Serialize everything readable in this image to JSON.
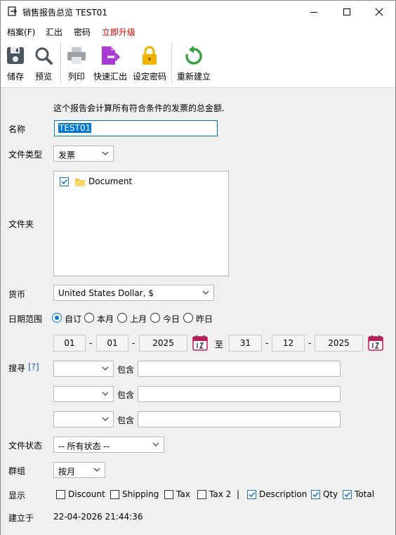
{
  "window": {
    "title": "销售报告总览 TEST01"
  },
  "menu": [
    "档案(F)",
    "汇出",
    "密码",
    "立即升级"
  ],
  "toolbar": {
    "save": "储存",
    "preview": "预览",
    "print": "列印",
    "quick_export": "快速汇出",
    "set_password": "设定密码",
    "rebuild": "重新建立"
  },
  "form": {
    "description": "这个报告会计算所有符合条件的发票的总金额.",
    "name_label": "名称",
    "name_value": "TEST01",
    "doctype_label": "文件类型",
    "doctype_value": "发票",
    "folder_label": "文件夹",
    "folder_item": "Document",
    "folder_checked": true,
    "currency_label": "货币",
    "currency_value": "United States Dollar, $",
    "date_label": "日期范围",
    "date_options": [
      "自订",
      "本月",
      "上月",
      "今日",
      "昨日"
    ],
    "date_selected": "自订",
    "from": {
      "day": "01",
      "month": "01",
      "year": "2025"
    },
    "to_label": "至",
    "to": {
      "day": "31",
      "month": "12",
      "year": "2025"
    },
    "date_sep": "-",
    "search_label": "搜寻",
    "search_help": "[?]",
    "contains": "包含",
    "status_label": "文件状态",
    "status_value": "-- 所有状态 --",
    "group_label": "群组",
    "group_value": "按月",
    "display_label": "显示",
    "display_sep": "|",
    "display_options": [
      {
        "label": "Discount",
        "checked": false
      },
      {
        "label": "Shipping",
        "checked": false
      },
      {
        "label": "Tax",
        "checked": false
      },
      {
        "label": "Tax 2",
        "checked": false
      },
      {
        "label": "Description",
        "checked": true
      },
      {
        "label": "Qty",
        "checked": true
      },
      {
        "label": "Total",
        "checked": true
      }
    ],
    "created_label": "建立于",
    "created_value": "22-04-2026 21:44:36"
  },
  "colors": {
    "accent": "#0078d7",
    "upgrade": "#e60000",
    "export_icon": "#a83bd1",
    "lock": "#f0b400",
    "refresh": "#3aa142"
  }
}
